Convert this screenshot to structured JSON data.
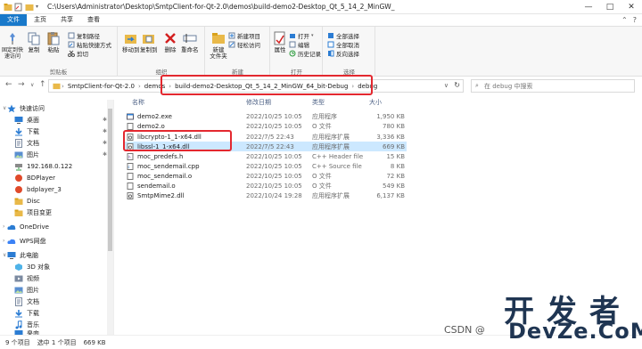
{
  "window": {
    "title": "C:\\Users\\Administrator\\Desktop\\SmtpClient-for-Qt-2.0\\demos\\build-demo2-Desktop_Qt_5_14_2_MinGW_",
    "controls": [
      "—",
      "□",
      "✕"
    ]
  },
  "ribbon_tabs": [
    "文件",
    "主页",
    "共享",
    "查看"
  ],
  "ribbon": {
    "clipboard": {
      "label": "剪贴板",
      "pin": "固定到快速访问",
      "copy": "复制",
      "paste": "粘贴",
      "copy_path": "复制路径",
      "paste_shortcut": "粘贴快捷方式",
      "cut": "剪切"
    },
    "organize": {
      "label": "组织",
      "move_to": "移动到",
      "copy_to": "复制到",
      "delete": "删除",
      "rename": "重命名"
    },
    "new": {
      "label": "新建",
      "new_folder": "新建\n文件夹",
      "new_item": "新建项目",
      "easy_access": "轻松访问"
    },
    "open": {
      "label": "打开",
      "properties": "属性",
      "open": "打开",
      "edit": "编辑",
      "history": "历史记录"
    },
    "select": {
      "label": "选择",
      "select_all": "全部选择",
      "select_none": "全部取消",
      "invert": "反向选择"
    }
  },
  "address": {
    "crumbs": [
      "SmtpClient-for-Qt-2.0",
      "demos",
      "build-demo2-Desktop_Qt_5_14_2_MinGW_64_bit-Debug",
      "debug"
    ],
    "search_placeholder": "在 debug 中搜索"
  },
  "nav_pane": {
    "items": [
      {
        "label": "快速访问",
        "icon": "star-icon",
        "color": "#2b7cd3"
      },
      {
        "label": "桌面",
        "icon": "desktop-icon",
        "color": "#2b7cd3"
      },
      {
        "label": "下载",
        "icon": "download-icon",
        "color": "#2b7cd3"
      },
      {
        "label": "文档",
        "icon": "document-icon",
        "color": "#7b8aa0"
      },
      {
        "label": "图片",
        "icon": "picture-icon",
        "color": "#5a8fd0"
      },
      {
        "label": "192.168.0.122",
        "icon": "network-drive-icon",
        "color": "#555"
      },
      {
        "label": "BDPlayer",
        "icon": "folder-icon",
        "color": "#d9a21b"
      },
      {
        "label": "bdplayer_3",
        "icon": "folder-icon",
        "color": "#d9a21b"
      },
      {
        "label": "Disc",
        "icon": "folder-icon",
        "color": "#e6b93a"
      },
      {
        "label": "项目变更",
        "icon": "folder-icon",
        "color": "#e6b93a"
      },
      {
        "label": "OneDrive",
        "icon": "cloud-icon",
        "color": "#2b7cd3"
      },
      {
        "label": "WPS网盘",
        "icon": "cloud-icon",
        "color": "#3b82f6"
      },
      {
        "label": "此电脑",
        "icon": "computer-icon",
        "color": "#2b7cd3"
      },
      {
        "label": "3D 对象",
        "icon": "3d-objects-icon",
        "color": "#4fb3e8"
      },
      {
        "label": "视频",
        "icon": "video-icon",
        "color": "#7b8aa0"
      },
      {
        "label": "图片",
        "icon": "picture-icon",
        "color": "#5a8fd0"
      },
      {
        "label": "文档",
        "icon": "document-icon",
        "color": "#7b8aa0"
      },
      {
        "label": "下载",
        "icon": "download-icon",
        "color": "#2b7cd3"
      },
      {
        "label": "音乐",
        "icon": "music-icon",
        "color": "#2b7cd3"
      },
      {
        "label": "桌面",
        "icon": "desktop-icon",
        "color": "#2b7cd3"
      }
    ]
  },
  "file_list": {
    "columns": [
      "名称",
      "修改日期",
      "类型",
      "大小"
    ],
    "rows": [
      {
        "name": "demo2.exe",
        "date": "2022/10/25 10:05",
        "type": "应用程序",
        "size": "1,950 KB",
        "icon": "exe-icon"
      },
      {
        "name": "demo2.o",
        "date": "2022/10/25 10:05",
        "type": "O 文件",
        "size": "780 KB",
        "icon": "file-icon"
      },
      {
        "name": "libcrypto-1_1-x64.dll",
        "date": "2022/7/5 22:43",
        "type": "应用程序扩展",
        "size": "3,336 KB",
        "icon": "dll-icon"
      },
      {
        "name": "libssl-1_1-x64.dll",
        "date": "2022/7/5 22:43",
        "type": "应用程序扩展",
        "size": "669 KB",
        "icon": "dll-icon"
      },
      {
        "name": "moc_predefs.h",
        "date": "2022/10/25 10:05",
        "type": "C++ Header file",
        "size": "15 KB",
        "icon": "header-icon"
      },
      {
        "name": "moc_sendemail.cpp",
        "date": "2022/10/25 10:05",
        "type": "C++ Source file",
        "size": "8 KB",
        "icon": "cpp-icon"
      },
      {
        "name": "moc_sendemail.o",
        "date": "2022/10/25 10:05",
        "type": "O 文件",
        "size": "72 KB",
        "icon": "file-icon"
      },
      {
        "name": "sendemail.o",
        "date": "2022/10/25 10:05",
        "type": "O 文件",
        "size": "549 KB",
        "icon": "file-icon"
      },
      {
        "name": "SmtpMime2.dll",
        "date": "2022/10/24 19:28",
        "type": "应用程序扩展",
        "size": "6,137 KB",
        "icon": "dll-icon"
      }
    ]
  },
  "status": {
    "count": "9 个项目",
    "selected": "选中 1 个项目",
    "size": "669 KB"
  },
  "watermark": {
    "cn": "开发者",
    "en": "DevZe.CoM",
    "csdn": "CSDN @"
  },
  "colors": {
    "accent": "#1979ca",
    "highlight_box": "#e3282f",
    "selection": "#cce8ff"
  }
}
